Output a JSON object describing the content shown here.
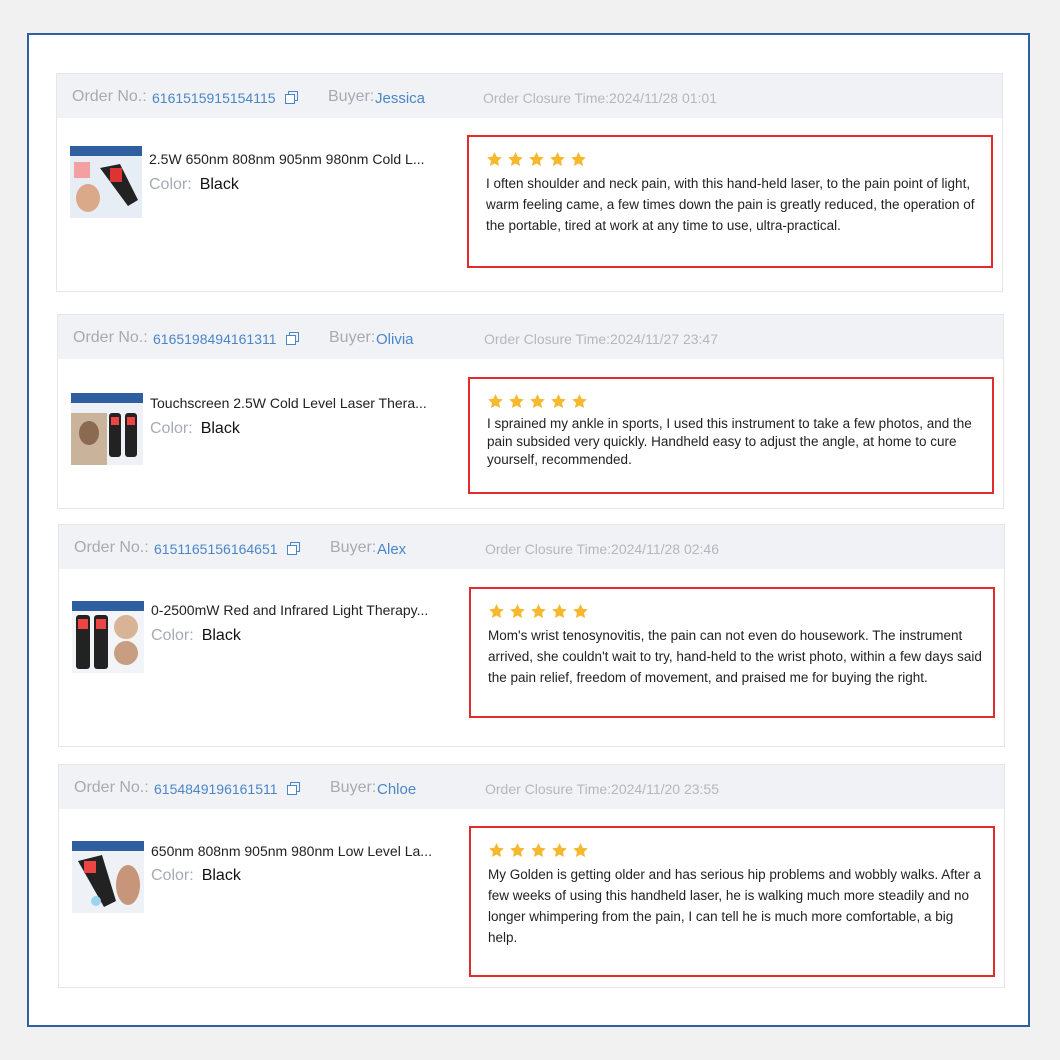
{
  "labels": {
    "order_no": "Order No.:",
    "buyer": "Buyer:",
    "color": "Color:"
  },
  "colors": {
    "frame_border": "#2f5fa0",
    "link_blue": "#4a86c8",
    "review_border": "#e32b2b",
    "star": "#f5b82e",
    "header_bg": "#f0f2f5"
  },
  "orders": [
    {
      "order_no": "6161515915154115",
      "buyer": "Jessica",
      "closure_time": "Order Closure Time:2024/11/28 01:01",
      "product_title": "2.5W 650nm 808nm 905nm 980nm Cold L...",
      "color": "Black",
      "rating": 5,
      "review": "I often shoulder and neck pain, with this hand-held laser, to the pain point of light, warm feeling came, a few times down the pain is greatly reduced, the operation of the portable, tired at work at any time to use, ultra-practical."
    },
    {
      "order_no": "6165198494161311",
      "buyer": "Olivia",
      "closure_time": "Order Closure Time:2024/11/27 23:47",
      "product_title": "Touchscreen 2.5W Cold Level Laser Thera...",
      "color": "Black",
      "rating": 5,
      "review": "I sprained my ankle in sports, I used this instrument to take a few photos, and the pain subsided very quickly. Handheld easy to adjust the angle, at home to cure yourself, recommended."
    },
    {
      "order_no": "6151165156164651",
      "buyer": "Alex",
      "closure_time": "Order Closure Time:2024/11/28 02:46",
      "product_title": "0-2500mW Red and Infrared Light Therapy...",
      "color": "Black",
      "rating": 5,
      "review": "Mom's wrist tenosynovitis, the pain can not even do housework. The instrument arrived, she couldn't wait to try, hand-held to the wrist photo, within a few days said the pain relief, freedom of movement, and praised me for buying the right."
    },
    {
      "order_no": "6154849196161511",
      "buyer": "Chloe",
      "closure_time": "Order Closure Time:2024/11/20 23:55",
      "product_title": "650nm 808nm 905nm 980nm Low Level La...",
      "color": "Black",
      "rating": 5,
      "review": "My Golden is getting older and has serious hip problems and wobbly walks. After a few weeks of using this handheld laser, he is walking much more steadily and no longer whimpering from the pain, I can tell he is much more comfortable, a big help."
    }
  ]
}
